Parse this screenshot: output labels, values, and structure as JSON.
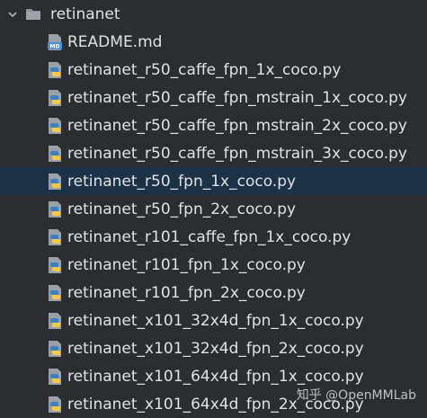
{
  "folder": {
    "name": "retinanet",
    "icon": "folder-icon",
    "expanded_icon": "chevron-down-icon"
  },
  "files": [
    {
      "name": "README.md",
      "icon": "markdown-file-icon"
    },
    {
      "name": "retinanet_r50_caffe_fpn_1x_coco.py",
      "icon": "python-file-icon"
    },
    {
      "name": "retinanet_r50_caffe_fpn_mstrain_1x_coco.py",
      "icon": "python-file-icon"
    },
    {
      "name": "retinanet_r50_caffe_fpn_mstrain_2x_coco.py",
      "icon": "python-file-icon"
    },
    {
      "name": "retinanet_r50_caffe_fpn_mstrain_3x_coco.py",
      "icon": "python-file-icon"
    },
    {
      "name": "retinanet_r50_fpn_1x_coco.py",
      "icon": "python-file-icon",
      "selected": true
    },
    {
      "name": "retinanet_r50_fpn_2x_coco.py",
      "icon": "python-file-icon"
    },
    {
      "name": "retinanet_r101_caffe_fpn_1x_coco.py",
      "icon": "python-file-icon"
    },
    {
      "name": "retinanet_r101_fpn_1x_coco.py",
      "icon": "python-file-icon"
    },
    {
      "name": "retinanet_r101_fpn_2x_coco.py",
      "icon": "python-file-icon"
    },
    {
      "name": "retinanet_x101_32x4d_fpn_1x_coco.py",
      "icon": "python-file-icon"
    },
    {
      "name": "retinanet_x101_32x4d_fpn_2x_coco.py",
      "icon": "python-file-icon"
    },
    {
      "name": "retinanet_x101_64x4d_fpn_1x_coco.py",
      "icon": "python-file-icon"
    },
    {
      "name": "retinanet_x101_64x4d_fpn_2x_coco.py",
      "icon": "python-file-icon"
    }
  ],
  "watermark": "知乎 @OpenMMLab",
  "colors": {
    "background": "#2b2d30",
    "selection": "#1d3246",
    "text": "#dfe1e5",
    "folder": "#8c9099",
    "python_blue": "#3f7fbf",
    "python_yellow": "#f2c94c",
    "markdown_blue": "#4a8fd9"
  }
}
